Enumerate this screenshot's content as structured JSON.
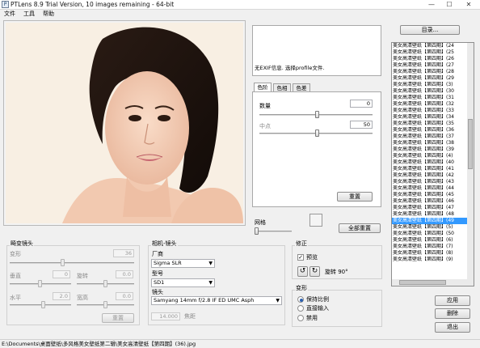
{
  "window": {
    "title": "PTLens 8.9 Trial Version, 10 images remaining - 64-bit",
    "icon_label": "P",
    "minimize": "—",
    "maximize": "☐",
    "close": "✕"
  },
  "menu": [
    "文件",
    "工具",
    "帮助"
  ],
  "exif": {
    "text": "无EXIF信息. 选择profile文件."
  },
  "tone": {
    "tabs": [
      "色阶",
      "色相",
      "色差"
    ],
    "amount_label": "数量",
    "amount_value": "0",
    "midpoint_label": "中点",
    "midpoint_value": "50",
    "reset": "重置"
  },
  "grid_label": "网格",
  "reset_all": "全部重置",
  "directory_button": "目录...",
  "file_list": {
    "items": [
      "美女高清壁纸【第四期】(24",
      "美女高清壁纸【第四期】(25",
      "美女高清壁纸【第四期】(26",
      "美女高清壁纸【第四期】(27",
      "美女高清壁纸【第四期】(28",
      "美女高清壁纸【第四期】(29",
      "美女高清壁纸【第四期】(3)",
      "美女高清壁纸【第四期】(30",
      "美女高清壁纸【第四期】(31",
      "美女高清壁纸【第四期】(32",
      "美女高清壁纸【第四期】(33",
      "美女高清壁纸【第四期】(34",
      "美女高清壁纸【第四期】(35",
      "美女高清壁纸【第四期】(36",
      "美女高清壁纸【第四期】(37",
      "美女高清壁纸【第四期】(38",
      "美女高清壁纸【第四期】(39",
      "美女高清壁纸【第四期】(4)",
      "美女高清壁纸【第四期】(40",
      "美女高清壁纸【第四期】(41",
      "美女高清壁纸【第四期】(42",
      "美女高清壁纸【第四期】(43",
      "美女高清壁纸【第四期】(44",
      "美女高清壁纸【第四期】(45",
      "美女高清壁纸【第四期】(46",
      "美女高清壁纸【第四期】(47",
      "美女高清壁纸【第四期】(48",
      "美女高清壁纸【第四期】(49",
      "美女高清壁纸【第四期】(5)",
      "美女高清壁纸【第四期】(50",
      "美女高清壁纸【第四期】(6)",
      "美女高清壁纸【第四期】(7)",
      "美女高清壁纸【第四期】(8)",
      "美女高清壁纸【第四期】(9)"
    ],
    "selected_index": 27
  },
  "distortion": {
    "title": "畸变镜头",
    "amount_label": "变形",
    "amount_value": "36",
    "vertical_label": "垂直",
    "vertical_value": "0",
    "rotate_label": "旋转",
    "rotate_value": "0.0",
    "horizontal_label": "水平",
    "horizontal_value": "2.0",
    "aspect_label": "宽高",
    "aspect_value": "0.0",
    "reset": "重置"
  },
  "camera": {
    "title": "相机-镜头",
    "maker_label": "厂商",
    "maker_value": "Sigma SLR",
    "model_label": "型号",
    "model_value": "SD1",
    "lens_label": "镜头",
    "lens_value": "Samyang 14mm f/2.8 IF ED UMC Asph",
    "focal_value": "14.000",
    "focal_label": "焦距"
  },
  "correction": {
    "title": "修正",
    "preview_label": "预览",
    "rotate_label": "旋转 90°",
    "rotate_left_icon": "↺",
    "rotate_right_icon": "↻"
  },
  "transform": {
    "title": "变形",
    "options": [
      "保持比例",
      "直接输入",
      "禁用"
    ],
    "selected": 0
  },
  "actions": {
    "apply": "应用",
    "delete": "删除",
    "exit": "退出"
  },
  "status": {
    "path": "E:\\Documents\\桌面壁纸\\多风格美女壁纸第二辑\\美女高清壁纸【第四期】(36).jpg"
  }
}
